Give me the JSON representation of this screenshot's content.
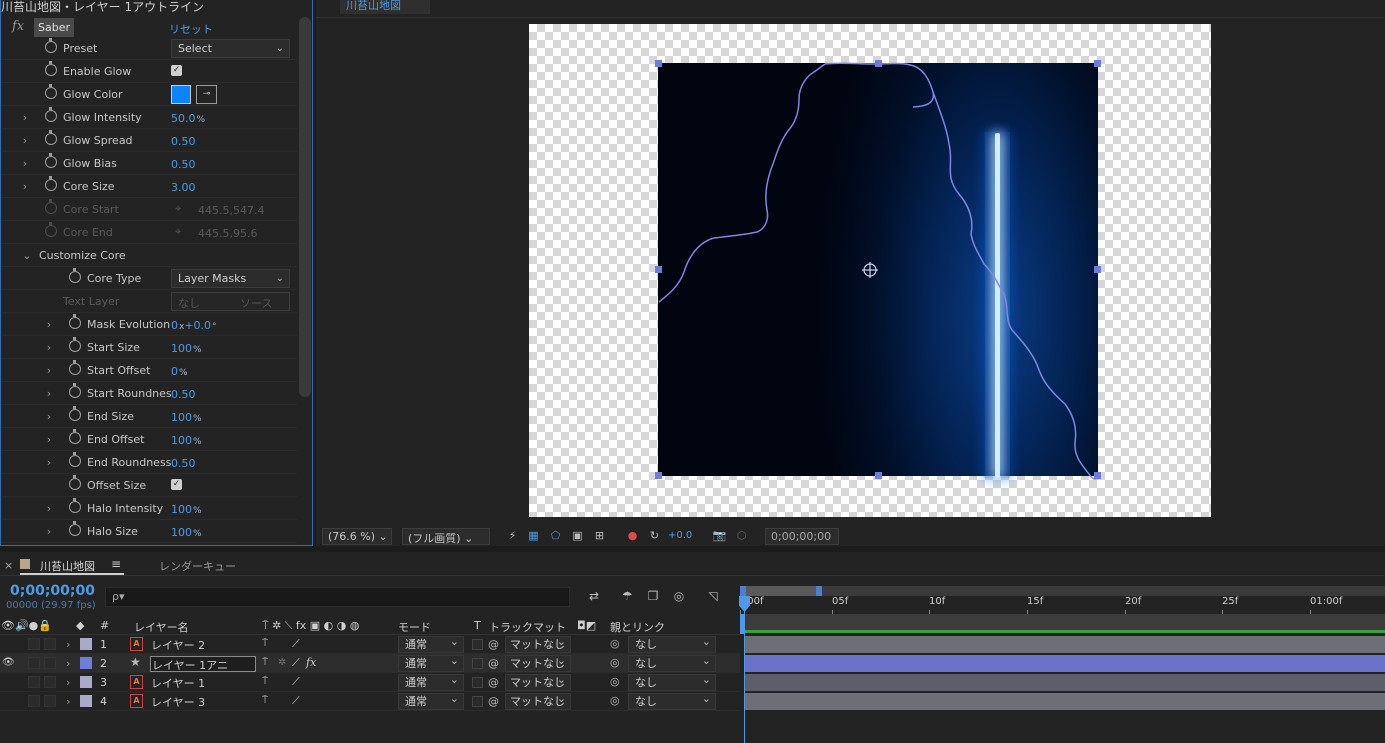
{
  "effects_panel": {
    "title": "川苔山地図・レイヤー 1アウトライン",
    "effect_name": "Saber",
    "reset_label": "リセット",
    "properties": [
      {
        "name": "Preset",
        "type": "dropdown",
        "value": "Select"
      },
      {
        "name": "Enable Glow",
        "type": "checkbox",
        "value": "✓"
      },
      {
        "name": "Glow Color",
        "type": "color",
        "value": "#0a84ff"
      },
      {
        "name": "Glow Intensity",
        "type": "number",
        "value": "50.0",
        "unit": "%"
      },
      {
        "name": "Glow Spread",
        "type": "number",
        "value": "0.50"
      },
      {
        "name": "Glow Bias",
        "type": "number",
        "value": "0.50"
      },
      {
        "name": "Core Size",
        "type": "number",
        "value": "3.00"
      },
      {
        "name": "Core Start",
        "type": "point",
        "value": "445.5,547.4",
        "disabled": true
      },
      {
        "name": "Core End",
        "type": "point",
        "value": "445.5,95.6",
        "disabled": true
      },
      {
        "name": "Customize Core",
        "type": "group"
      },
      {
        "name": "Core Type",
        "type": "dropdown",
        "value": "Layer Masks"
      },
      {
        "name": "Text Layer",
        "type": "dual-dropdown",
        "value": "なし",
        "value2": "ソース",
        "disabled": true
      },
      {
        "name": "Mask Evolution",
        "type": "number",
        "value": "0",
        "unit": "x",
        "value2": "+0.0",
        "unit2": "°"
      },
      {
        "name": "Start Size",
        "type": "number",
        "value": "100",
        "unit": "%"
      },
      {
        "name": "Start Offset",
        "type": "number",
        "value": "0",
        "unit": "%"
      },
      {
        "name": "Start Roundnes",
        "type": "number",
        "value": "0.50"
      },
      {
        "name": "End Size",
        "type": "number",
        "value": "100",
        "unit": "%"
      },
      {
        "name": "End Offset",
        "type": "number",
        "value": "100",
        "unit": "%"
      },
      {
        "name": "End Roundness",
        "type": "number",
        "value": "0.50"
      },
      {
        "name": "Offset Size",
        "type": "checkbox",
        "value": "✓"
      },
      {
        "name": "Halo Intensity",
        "type": "number",
        "value": "100",
        "unit": "%"
      },
      {
        "name": "Halo Size",
        "type": "number",
        "value": "100",
        "unit": "%"
      }
    ]
  },
  "composition_panel": {
    "tab": "川苔山地図",
    "zoom": "(76.6 %)",
    "resolution": "(フル画質)",
    "exposure": "+0.0",
    "timecode": "0;00;00;00",
    "saber_color": "#3fb4ff"
  },
  "timeline": {
    "tab_comp": "川苔山地図",
    "tab_menu": "≡",
    "tab_render": "レンダーキュー",
    "timecode": "0;00;00;00",
    "frame_fps": "00000 (29.97 fps)",
    "search_placeholder": "ρ▾",
    "columns": {
      "num": "#",
      "layer_name": "レイヤー名",
      "mode": "モード",
      "t": "T",
      "track_matte": "トラックマット",
      "parent": "親とリンク"
    },
    "ruler_ticks": [
      "):00f",
      "05f",
      "10f",
      "15f",
      "20f",
      "25f",
      "01:00f"
    ],
    "layers": [
      {
        "num": "1",
        "name": "レイヤー 2",
        "color": "#a9a9c9",
        "mode": "通常",
        "matte": "マットなし",
        "parent": "なし",
        "type": "text"
      },
      {
        "num": "2",
        "name": "レイヤー 1アニ",
        "color": "#6f7fd8",
        "mode": "通常",
        "matte": "マットなし",
        "parent": "なし",
        "type": "shape",
        "selected": true
      },
      {
        "num": "3",
        "name": "レイヤー 1",
        "color": "#a9a9c9",
        "mode": "通常",
        "matte": "マットなし",
        "parent": "なし",
        "type": "text"
      },
      {
        "num": "4",
        "name": "レイヤー 3",
        "color": "#a9a9c9",
        "mode": "通常",
        "matte": "マットなし",
        "parent": "なし",
        "type": "text"
      }
    ]
  }
}
